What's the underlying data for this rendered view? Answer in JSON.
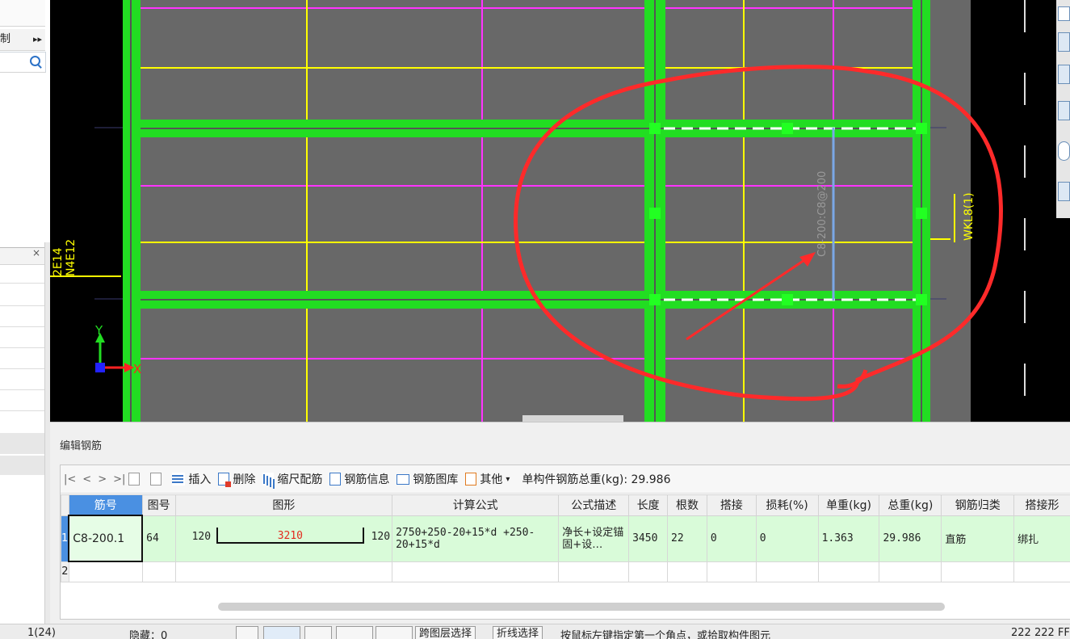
{
  "left_panel": {
    "label_fragment": "制",
    "arrows": "▸▸",
    "close_symbol": "×"
  },
  "canvas": {
    "annotation_vertical": "C8-200:C8@200",
    "beam_label": "WKL8(1)",
    "left_label_1": "2E14",
    "left_label_2": "N4E12",
    "axis_x": "X",
    "axis_y": "Y",
    "colors": {
      "background": "#000000",
      "slab": "#686868",
      "beam": "#22dd22",
      "yellow_line": "#ffff00",
      "magenta_line": "#ff33ff",
      "annotation": "#ff2a2a",
      "selected_rebar": "#7aa7e6"
    }
  },
  "edit_panel": {
    "title": "编辑钢筋",
    "toolbar": {
      "nav_first": "|<",
      "nav_prev": "<",
      "nav_next": ">",
      "nav_last": ">|",
      "insert": "插入",
      "delete": "删除",
      "scale_rebar": "缩尺配筋",
      "rebar_info": "钢筋信息",
      "rebar_library": "钢筋图库",
      "other": "其他",
      "other_caret": "▾",
      "total_weight": "单构件钢筋总重(kg): 29.986"
    },
    "columns": [
      "筋号",
      "图号",
      "图形",
      "计算公式",
      "公式描述",
      "长度",
      "根数",
      "搭接",
      "损耗(%)",
      "单重(kg)",
      "总重(kg)",
      "钢筋归类",
      "搭接形"
    ],
    "rows": [
      {
        "num": "1",
        "bar_id": "C8-200.1",
        "figure_no": "64",
        "shape_left": "120",
        "shape_mid": "3210",
        "shape_right": "120",
        "formula": "2750+250-20+15*d +250-20+15*d",
        "description": "净长+设定锚固+设…",
        "length": "3450",
        "count": "22",
        "lap": "0",
        "loss": "0",
        "unit_weight": "1.363",
        "total_weight": "29.986",
        "category": "直筋",
        "lap_type": "绑扎"
      },
      {
        "num": "2"
      }
    ]
  },
  "status_bar": {
    "page": "1(24)",
    "hidden": "隐藏：0",
    "select_layer": "跨图层选择",
    "polyline_select": "折线选择",
    "hint": "按鼠标左键指定第一个角点，或拾取构件图元",
    "coords": "222 222 FF"
  }
}
